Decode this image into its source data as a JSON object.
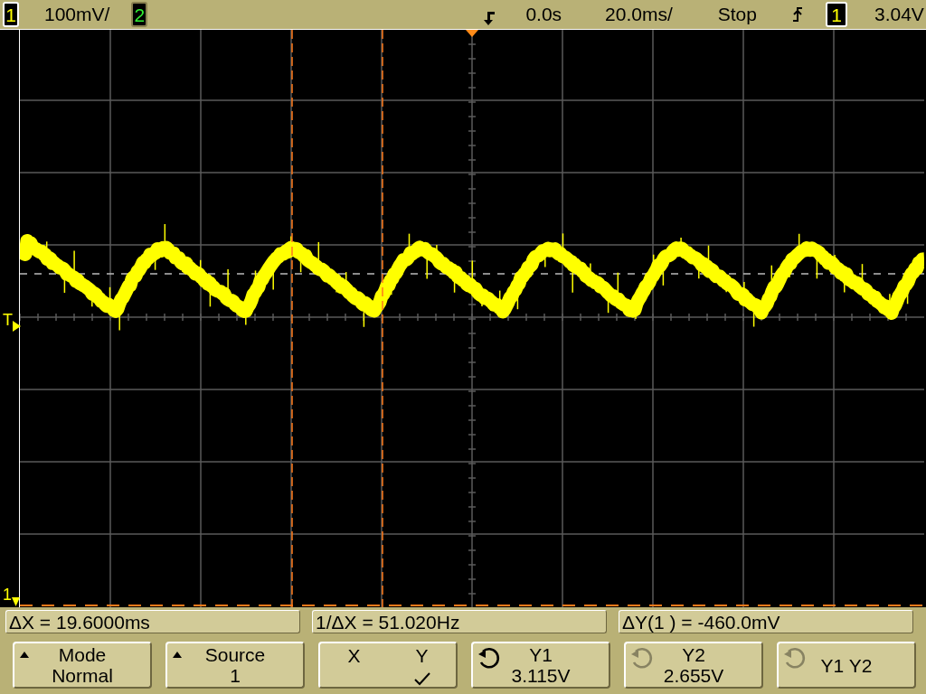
{
  "header": {
    "channel_1": "1",
    "scale": "100mV/",
    "channel_2": "2",
    "delay": "0.0s",
    "timebase": "20.0ms/",
    "run_state": "Stop",
    "trigger_source": "1",
    "trigger_level": "3.04V"
  },
  "display": {
    "trigger_marker": "T",
    "ground_marker": "1"
  },
  "measurements": [
    "ΔX = 19.6000ms",
    "1/ΔX = 51.020Hz",
    "ΔY(1 ) = -460.0mV"
  ],
  "softkeys": [
    {
      "kind": "menu",
      "title": "Mode",
      "value": "Normal"
    },
    {
      "kind": "menu",
      "title": "Source",
      "value": "1"
    },
    {
      "kind": "toggle",
      "options": [
        {
          "label": "X",
          "selected": false
        },
        {
          "label": "Y",
          "selected": true
        }
      ]
    },
    {
      "kind": "knob",
      "title": "Y1",
      "value": "3.115V",
      "active": true
    },
    {
      "kind": "knob",
      "title": "Y2",
      "value": "2.655V",
      "active": false
    },
    {
      "kind": "knob",
      "title": "Y1 Y2",
      "active": false
    }
  ]
}
